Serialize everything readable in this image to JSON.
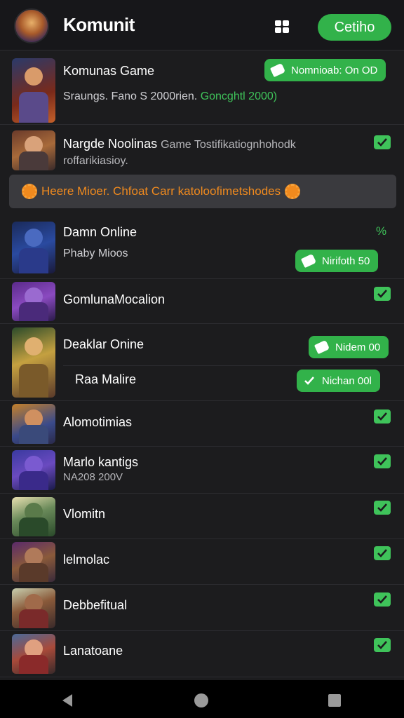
{
  "header": {
    "title": "Komunit",
    "grid_icon": "grid-icon",
    "cta_label": "Cetiho"
  },
  "rows": [
    {
      "name": "Komunas Game",
      "subtitle": "Sraungs. Fano S 2000rien.",
      "subtitle_accent": "Goncghtl 2000)",
      "action": "Nomnioab: On OD"
    },
    {
      "name": "Nargde Noolinas",
      "subtitle_inline": "Game Tostifikatiognhohodk",
      "subtitle": "roffarikiasioy."
    },
    {
      "name": "Damn Online",
      "subtitle": "Phaby Mioos",
      "corner_icon": "%",
      "action": "Nirifoth 50"
    },
    {
      "name": "GomlunaMocalion"
    },
    {
      "name": "Deaklar Onine",
      "action": "Nidem 00"
    },
    {
      "name": "Raa Malire",
      "action": "Nichan 00l"
    },
    {
      "name": "Alomotimias"
    },
    {
      "name": "Marlo kantigs",
      "subtitle": "NA208 200V"
    },
    {
      "name": "Vlomitn"
    },
    {
      "name": "lelmolac"
    },
    {
      "name": "Debbefitual"
    },
    {
      "name": "Lanatoane"
    }
  ],
  "banner": {
    "text": "Heere Mioer. Chfoat Carr katoloofimetshodes"
  },
  "colors": {
    "accent": "#32b24a",
    "warning": "#f08a1e",
    "background": "#1c1c1e"
  }
}
